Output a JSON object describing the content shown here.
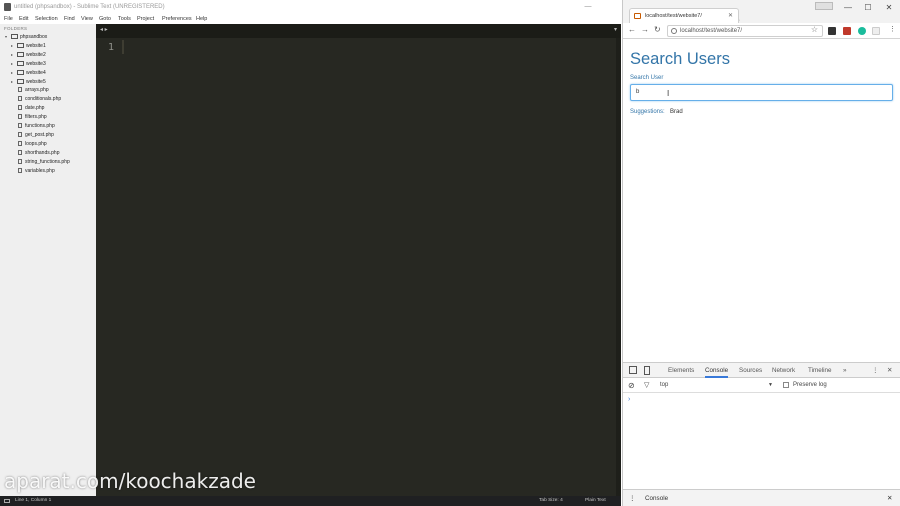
{
  "sublime": {
    "window_title": "untitled (phpsandbox) - Sublime Text (UNREGISTERED)",
    "menu": [
      "File",
      "Edit",
      "Selection",
      "Find",
      "View",
      "Goto",
      "Tools",
      "Project",
      "Preferences",
      "Help"
    ],
    "sidebar_header": "FOLDERS",
    "tree": [
      {
        "label": "phpsandbox",
        "type": "folder",
        "expanded": true
      },
      {
        "label": "website1",
        "type": "folder"
      },
      {
        "label": "website2",
        "type": "folder"
      },
      {
        "label": "website3",
        "type": "folder"
      },
      {
        "label": "website4",
        "type": "folder"
      },
      {
        "label": "website5",
        "type": "folder"
      },
      {
        "label": "arrays.php",
        "type": "file"
      },
      {
        "label": "conditionals.php",
        "type": "file"
      },
      {
        "label": "date.php",
        "type": "file"
      },
      {
        "label": "filters.php",
        "type": "file"
      },
      {
        "label": "functions.php",
        "type": "file"
      },
      {
        "label": "get_post.php",
        "type": "file"
      },
      {
        "label": "loops.php",
        "type": "file"
      },
      {
        "label": "shorthands.php",
        "type": "file"
      },
      {
        "label": "string_functions.php",
        "type": "file"
      },
      {
        "label": "variables.php",
        "type": "file"
      }
    ],
    "tab_nav": "◂ ▸",
    "line_number": "1",
    "status": {
      "position": "Line 1, Column 1",
      "tab_size": "Tab Size: 4",
      "syntax": "Plain Text"
    }
  },
  "browser": {
    "tab_title": "localhost/test/website7/",
    "address": "localhost/test/website7/",
    "page": {
      "heading": "Search Users",
      "field_label": "Search User",
      "input_value": "b",
      "suggestions_label": "Suggestions:",
      "suggestions_value": "Brad"
    },
    "devtools": {
      "tabs": [
        "Elements",
        "Console",
        "Sources",
        "Network",
        "Timeline"
      ],
      "more": "»",
      "active_tab": "Console",
      "context": "top",
      "preserve_log": "Preserve log",
      "prompt": "›",
      "drawer_tab": "Console"
    }
  },
  "watermark": "aparat.com/koochakzade",
  "colors": {
    "editor_bg": "#272822",
    "sidebar_bg": "#efefef",
    "heading": "#3375a8",
    "accent": "#3879d9"
  }
}
